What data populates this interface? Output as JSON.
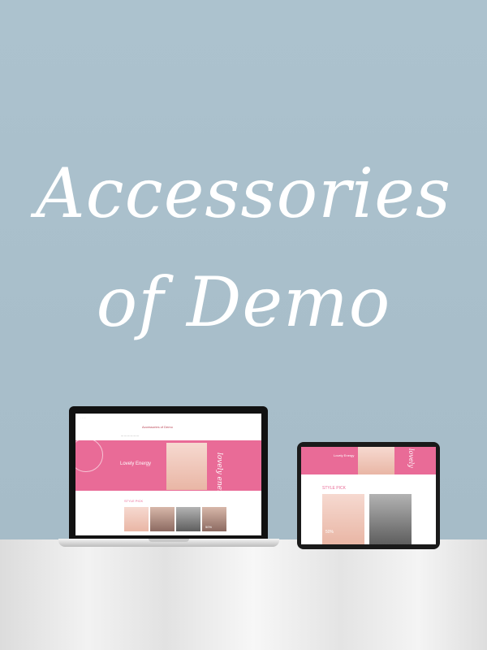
{
  "headline": {
    "line1": "Accessories",
    "line2": "of Demo"
  },
  "laptop_site": {
    "brand": "Accessories of Demo",
    "banner_title": "Lovely Energy",
    "banner_script": "lovely energy",
    "section_title": "STYLE PICK",
    "product_badge": "50%",
    "product_tag": "OFF"
  },
  "tablet_site": {
    "banner_title": "Lovely Energy",
    "banner_script": "lovely",
    "section_title": "STYLE PICK",
    "product_badge": "50%"
  },
  "colors": {
    "background": "#a9bfcb",
    "accent": "#e96b97",
    "text_white": "#ffffff"
  }
}
